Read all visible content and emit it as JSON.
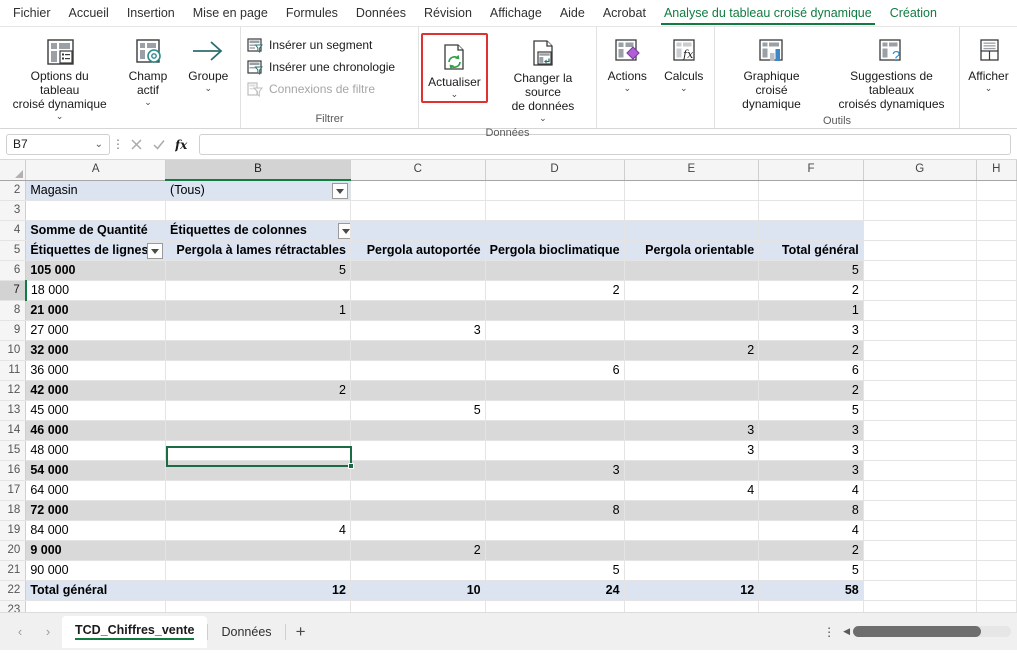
{
  "ribbon_tabs": [
    {
      "label": "Fichier",
      "type": "normal"
    },
    {
      "label": "Accueil",
      "type": "normal"
    },
    {
      "label": "Insertion",
      "type": "normal"
    },
    {
      "label": "Mise en page",
      "type": "normal"
    },
    {
      "label": "Formules",
      "type": "normal"
    },
    {
      "label": "Données",
      "type": "normal"
    },
    {
      "label": "Révision",
      "type": "normal"
    },
    {
      "label": "Affichage",
      "type": "normal"
    },
    {
      "label": "Aide",
      "type": "normal"
    },
    {
      "label": "Acrobat",
      "type": "normal"
    },
    {
      "label": "Analyse du tableau croisé dynamique",
      "type": "contextual-active"
    },
    {
      "label": "Création",
      "type": "contextual"
    }
  ],
  "ribbon": {
    "groups": [
      {
        "name": "",
        "label": "",
        "buttons": [
          {
            "label": "Options du tableau\ncroisé dynamique",
            "icon": "pivot-options-icon",
            "chevron": true
          },
          {
            "label": "Champ\nactif",
            "icon": "active-field-icon",
            "chevron": true
          },
          {
            "label": "Groupe",
            "icon": "group-arrow-icon",
            "chevron": true
          }
        ]
      },
      {
        "name": "filtrer",
        "label": "Filtrer",
        "small_buttons": [
          {
            "label": "Insérer un segment",
            "icon": "slicer-icon",
            "disabled": false
          },
          {
            "label": "Insérer une chronologie",
            "icon": "timeline-icon",
            "disabled": false
          },
          {
            "label": "Connexions de filtre",
            "icon": "filter-connections-icon",
            "disabled": true
          }
        ]
      },
      {
        "name": "donnees",
        "label": "Données",
        "buttons": [
          {
            "label": "Actualiser",
            "icon": "refresh-icon",
            "chevron": true,
            "highlighted": true
          },
          {
            "label": "Changer la source\nde données",
            "icon": "change-datasource-icon",
            "chevron": true
          }
        ]
      },
      {
        "name": "actions-calculs",
        "label": "",
        "buttons": [
          {
            "label": "Actions",
            "icon": "actions-icon",
            "chevron": true
          },
          {
            "label": "Calculs",
            "icon": "calculations-icon",
            "chevron": true
          }
        ]
      },
      {
        "name": "outils",
        "label": "Outils",
        "buttons": [
          {
            "label": "Graphique croisé\ndynamique",
            "icon": "pivotchart-icon",
            "chevron": false
          },
          {
            "label": "Suggestions de tableaux\ncroisés dynamiques",
            "icon": "recommended-pivot-icon",
            "chevron": false
          }
        ]
      },
      {
        "name": "afficher",
        "label": "",
        "buttons": [
          {
            "label": "Afficher",
            "icon": "show-icon",
            "chevron": true
          }
        ]
      }
    ]
  },
  "formula_bar": {
    "name_box_value": "B7",
    "name_box_chevron": "chevron-down-icon",
    "cancel_icon": "cancel-icon",
    "confirm_icon": "confirm-icon",
    "function_icon": "fx-icon",
    "formula_value": ""
  },
  "grid": {
    "column_headers": [
      "A",
      "B",
      "C",
      "D",
      "E",
      "F",
      "G",
      "H"
    ],
    "selected_column": "B",
    "selected_row": "7",
    "selected_cell": "B7",
    "row_numbers": [
      "2",
      "3",
      "4",
      "5",
      "6",
      "7",
      "8",
      "9",
      "10",
      "11",
      "12",
      "13",
      "14",
      "15",
      "16",
      "17",
      "18",
      "19",
      "20",
      "21",
      "22",
      "23"
    ],
    "filter_field": {
      "label": "Magasin",
      "value": "(Tous)",
      "dropdown_icon": "filter-dropdown-icon"
    },
    "pivot_headers": {
      "value_caption": "Somme de Quantité",
      "column_labels_caption": "Étiquettes de colonnes",
      "column_labels_dropdown_icon": "filter-dropdown-icon",
      "row_labels_caption": "Étiquettes de lignes",
      "row_labels_dropdown_icon": "filter-dropdown-icon"
    },
    "columns": [
      "Pergola à lames rétractables",
      "Pergola autoportée",
      "Pergola bioclimatique",
      "Pergola orientable",
      "Total général"
    ],
    "rows": [
      {
        "row": "6",
        "label": "105 000",
        "values": [
          "5",
          "",
          "",
          "",
          "5"
        ]
      },
      {
        "row": "7",
        "label": "18 000",
        "values": [
          "",
          "",
          "2",
          "",
          "2"
        ]
      },
      {
        "row": "8",
        "label": "21 000",
        "values": [
          "1",
          "",
          "",
          "",
          "1"
        ]
      },
      {
        "row": "9",
        "label": "27 000",
        "values": [
          "",
          "3",
          "",
          "",
          "3"
        ]
      },
      {
        "row": "10",
        "label": "32 000",
        "values": [
          "",
          "",
          "",
          "2",
          "2"
        ]
      },
      {
        "row": "11",
        "label": "36 000",
        "values": [
          "",
          "",
          "6",
          "",
          "6"
        ]
      },
      {
        "row": "12",
        "label": "42 000",
        "values": [
          "2",
          "",
          "",
          "",
          "2"
        ]
      },
      {
        "row": "13",
        "label": "45 000",
        "values": [
          "",
          "5",
          "",
          "",
          "5"
        ]
      },
      {
        "row": "14",
        "label": "46 000",
        "values": [
          "",
          "",
          "",
          "3",
          "3"
        ]
      },
      {
        "row": "15",
        "label": "48 000",
        "values": [
          "",
          "",
          "",
          "3",
          "3"
        ]
      },
      {
        "row": "16",
        "label": "54 000",
        "values": [
          "",
          "",
          "3",
          "",
          "3"
        ]
      },
      {
        "row": "17",
        "label": "64 000",
        "values": [
          "",
          "",
          "",
          "4",
          "4"
        ]
      },
      {
        "row": "18",
        "label": "72 000",
        "values": [
          "",
          "",
          "8",
          "",
          "8"
        ]
      },
      {
        "row": "19",
        "label": "84 000",
        "values": [
          "4",
          "",
          "",
          "",
          "4"
        ]
      },
      {
        "row": "20",
        "label": "9 000",
        "values": [
          "",
          "2",
          "",
          "",
          "2"
        ]
      },
      {
        "row": "21",
        "label": "90 000",
        "values": [
          "",
          "",
          "5",
          "",
          "5"
        ]
      }
    ],
    "total_row": {
      "row": "22",
      "label": "Total général",
      "values": [
        "12",
        "10",
        "24",
        "12",
        "58"
      ]
    }
  },
  "sheet_bar": {
    "prev_icon": "chevron-left-icon",
    "next_icon": "chevron-right-icon",
    "tabs": [
      {
        "label": "TCD_Chiffres_vente",
        "active": true
      },
      {
        "label": "Données",
        "active": false
      }
    ],
    "add_sheet_icon": "plus-icon",
    "more_icon": "vertical-dots-icon",
    "scroll_left_icon": "scroll-left-arrow-icon"
  },
  "colors": {
    "accent_green": "#107c41",
    "highlight_red": "#e03131",
    "pivot_header_blue": "#dce4f2",
    "band_gray": "#d9d9d9"
  }
}
